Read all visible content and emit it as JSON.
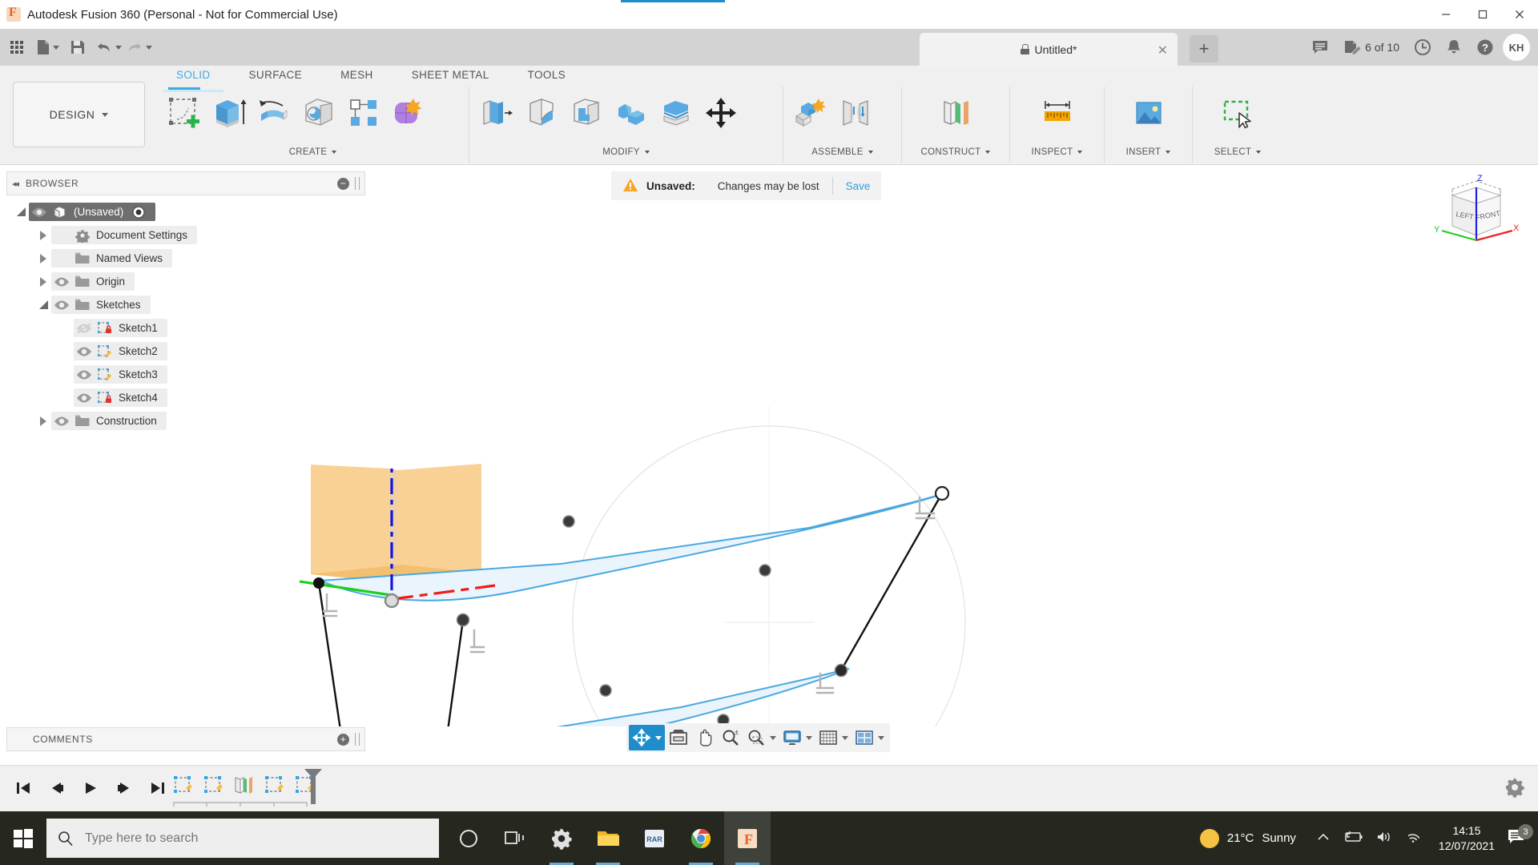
{
  "window": {
    "title": "Autodesk Fusion 360 (Personal - Not for Commercial Use)",
    "minimize": "—",
    "maximize": "❐",
    "close": "✕"
  },
  "quick_access": {
    "grid_label": "app-grid",
    "new_label": "new-document",
    "save_label": "save",
    "undo_label": "undo",
    "redo_label": "redo",
    "tab_title": "Untitled*",
    "tab_close": "✕",
    "add_tab": "+",
    "job_status": "6 of 10",
    "avatar_initials": "KH"
  },
  "ribbon": {
    "design_label": "DESIGN",
    "tabs": [
      {
        "label": "SOLID",
        "active": true
      },
      {
        "label": "SURFACE",
        "active": false
      },
      {
        "label": "MESH",
        "active": false
      },
      {
        "label": "SHEET METAL",
        "active": false
      },
      {
        "label": "TOOLS",
        "active": false
      }
    ],
    "panels": [
      {
        "label": "CREATE",
        "tools": [
          "create-sketch",
          "extrude",
          "revolve",
          "hole",
          "rectangular-pattern",
          "form"
        ]
      },
      {
        "label": "MODIFY",
        "tools": [
          "press-pull",
          "fillet",
          "shell",
          "combine",
          "offset-face",
          "move-copy"
        ]
      },
      {
        "label": "ASSEMBLE",
        "tools": [
          "new-component",
          "joint"
        ]
      },
      {
        "label": "CONSTRUCT",
        "tools": [
          "offset-plane"
        ]
      },
      {
        "label": "INSPECT",
        "tools": [
          "measure"
        ]
      },
      {
        "label": "INSERT",
        "tools": [
          "insert-image"
        ]
      },
      {
        "label": "SELECT",
        "tools": [
          "select-window"
        ]
      }
    ]
  },
  "browser": {
    "title": "BROWSER",
    "collapse": "◂◂",
    "minus": "−",
    "tree": [
      {
        "label": "(Unsaved)",
        "indent": 0,
        "expander": "open",
        "eye": true,
        "icon": "component-icon",
        "selected": true,
        "radio": true
      },
      {
        "label": "Document Settings",
        "indent": 1,
        "expander": "closed",
        "eye": false,
        "icon": "gear-icon",
        "selected": false,
        "radio": false
      },
      {
        "label": "Named Views",
        "indent": 1,
        "expander": "closed",
        "eye": false,
        "icon": "folder-icon",
        "selected": false,
        "radio": false
      },
      {
        "label": "Origin",
        "indent": 1,
        "expander": "closed",
        "eye": true,
        "icon": "folder-icon",
        "selected": false,
        "radio": false
      },
      {
        "label": "Sketches",
        "indent": 1,
        "expander": "open",
        "eye": true,
        "icon": "folder-icon",
        "selected": false,
        "radio": false
      },
      {
        "label": "Sketch1",
        "indent": 2,
        "expander": "none",
        "eye": "hidden",
        "icon": "sketch-locked-icon",
        "selected": false,
        "radio": false
      },
      {
        "label": "Sketch2",
        "indent": 2,
        "expander": "none",
        "eye": true,
        "icon": "sketch-edit-icon",
        "selected": false,
        "radio": false
      },
      {
        "label": "Sketch3",
        "indent": 2,
        "expander": "none",
        "eye": true,
        "icon": "sketch-edit-icon",
        "selected": false,
        "radio": false
      },
      {
        "label": "Sketch4",
        "indent": 2,
        "expander": "none",
        "eye": true,
        "icon": "sketch-locked-icon",
        "selected": false,
        "radio": false
      },
      {
        "label": "Construction",
        "indent": 1,
        "expander": "closed",
        "eye": true,
        "icon": "folder-icon",
        "selected": false,
        "radio": false
      }
    ]
  },
  "comments": {
    "title": "COMMENTS",
    "plus": "+"
  },
  "notification": {
    "warning_icon": "warning-triangle",
    "label": "Unsaved:",
    "message": "Changes may be lost",
    "action": "Save"
  },
  "viewcube": {
    "face_left": "LEFT",
    "face_front": "FRONT",
    "axis_x": "X",
    "axis_y": "Y",
    "axis_z": "Z"
  },
  "navbar": {
    "items": [
      {
        "name": "orbit",
        "active": true,
        "caret": true
      },
      {
        "name": "look-at",
        "active": false,
        "caret": false
      },
      {
        "name": "pan",
        "active": false,
        "caret": false
      },
      {
        "name": "zoom",
        "active": false,
        "caret": false
      },
      {
        "name": "zoom-window",
        "active": false,
        "caret": true
      },
      {
        "name": "display-settings",
        "active": false,
        "caret": true
      },
      {
        "name": "grid-snaps",
        "active": false,
        "caret": true
      },
      {
        "name": "viewports",
        "active": false,
        "caret": true
      }
    ]
  },
  "timeline": {
    "controls": [
      "go-to-beginning",
      "step-back",
      "play",
      "step-forward",
      "go-to-end"
    ],
    "features": [
      "sketch1",
      "sketch2",
      "construction-plane",
      "sketch3",
      "sketch4"
    ],
    "settings": "timeline-settings"
  },
  "taskbar": {
    "search_placeholder": "Type here to search",
    "icons": [
      "cortana",
      "task-view",
      "settings",
      "file-explorer",
      "winrar",
      "chrome",
      "fusion360"
    ],
    "weather_temp": "21°C",
    "weather_desc": "Sunny",
    "time": "14:15",
    "date": "12/07/2021",
    "notification_count": "3"
  },
  "colors": {
    "accent_blue": "#1d8ecb",
    "tab_active": "#3ea8e0",
    "sketch_curve": "#4aa8e0",
    "sketch_fill": "#e8f4fc",
    "plane_orange": "#f7c97e",
    "axis_x": "#ee2222",
    "axis_y": "#22cc22",
    "axis_z": "#2222ee",
    "taskbar_bg": "#26281f",
    "ribbon_bg": "#f0f0f0"
  }
}
